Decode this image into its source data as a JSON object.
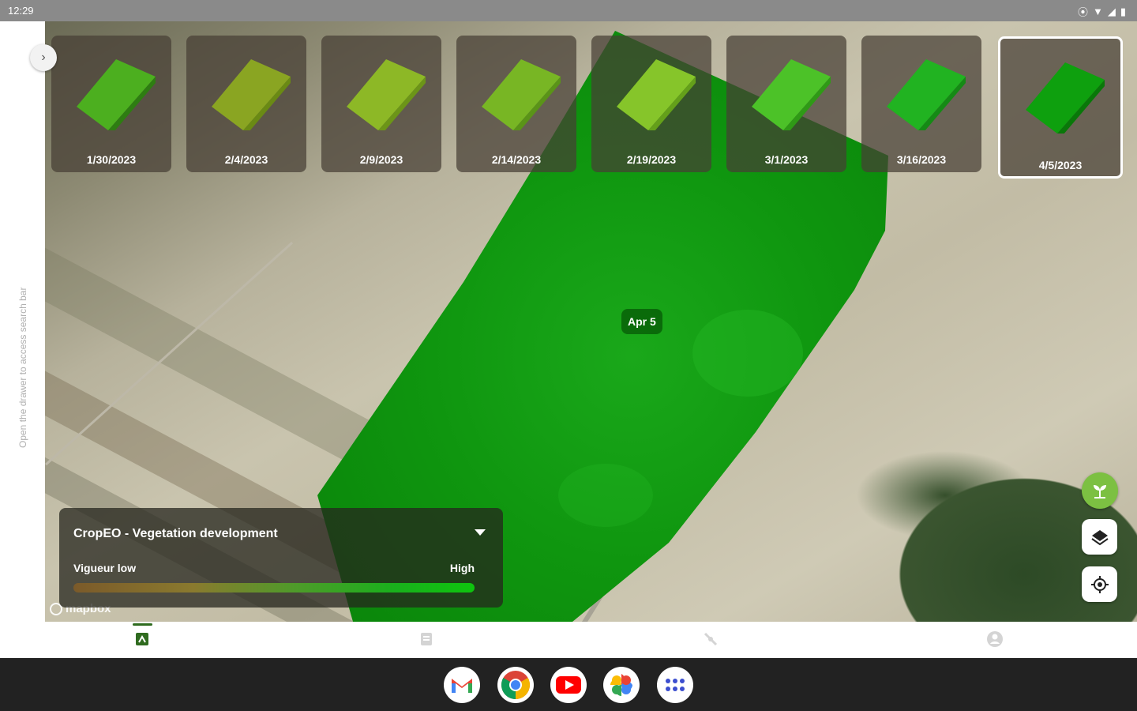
{
  "status_bar": {
    "time": "12:29"
  },
  "drawer": {
    "hint": "Open the drawer to access search bar"
  },
  "thumbnails": [
    {
      "date": "1/30/2023",
      "selected": false
    },
    {
      "date": "2/4/2023",
      "selected": false
    },
    {
      "date": "2/9/2023",
      "selected": false
    },
    {
      "date": "2/14/2023",
      "selected": false
    },
    {
      "date": "2/19/2023",
      "selected": false
    },
    {
      "date": "3/1/2023",
      "selected": false
    },
    {
      "date": "3/16/2023",
      "selected": false
    },
    {
      "date": "4/5/2023",
      "selected": true
    }
  ],
  "map": {
    "date_label": "Apr 5",
    "attribution": "mapbox"
  },
  "legend": {
    "title": "CropEO - Vegetation development",
    "low_label": "Vigueur low",
    "high_label": "High"
  },
  "fabs": {
    "plant": "plant-icon",
    "layers": "layers-icon",
    "locate": "my-location-icon"
  },
  "bottom_nav": [
    {
      "icon": "fields-icon",
      "active": true
    },
    {
      "icon": "document-icon",
      "active": false
    },
    {
      "icon": "satellite-icon",
      "active": false
    },
    {
      "icon": "account-icon",
      "active": false
    }
  ],
  "taskbar": [
    "gmail-icon",
    "chrome-icon",
    "youtube-icon",
    "photos-icon",
    "app-launcher-icon"
  ],
  "colors": {
    "accent_green": "#2f6b1f",
    "field_green": "#0f9a0f",
    "fab_green": "#7cc042"
  }
}
